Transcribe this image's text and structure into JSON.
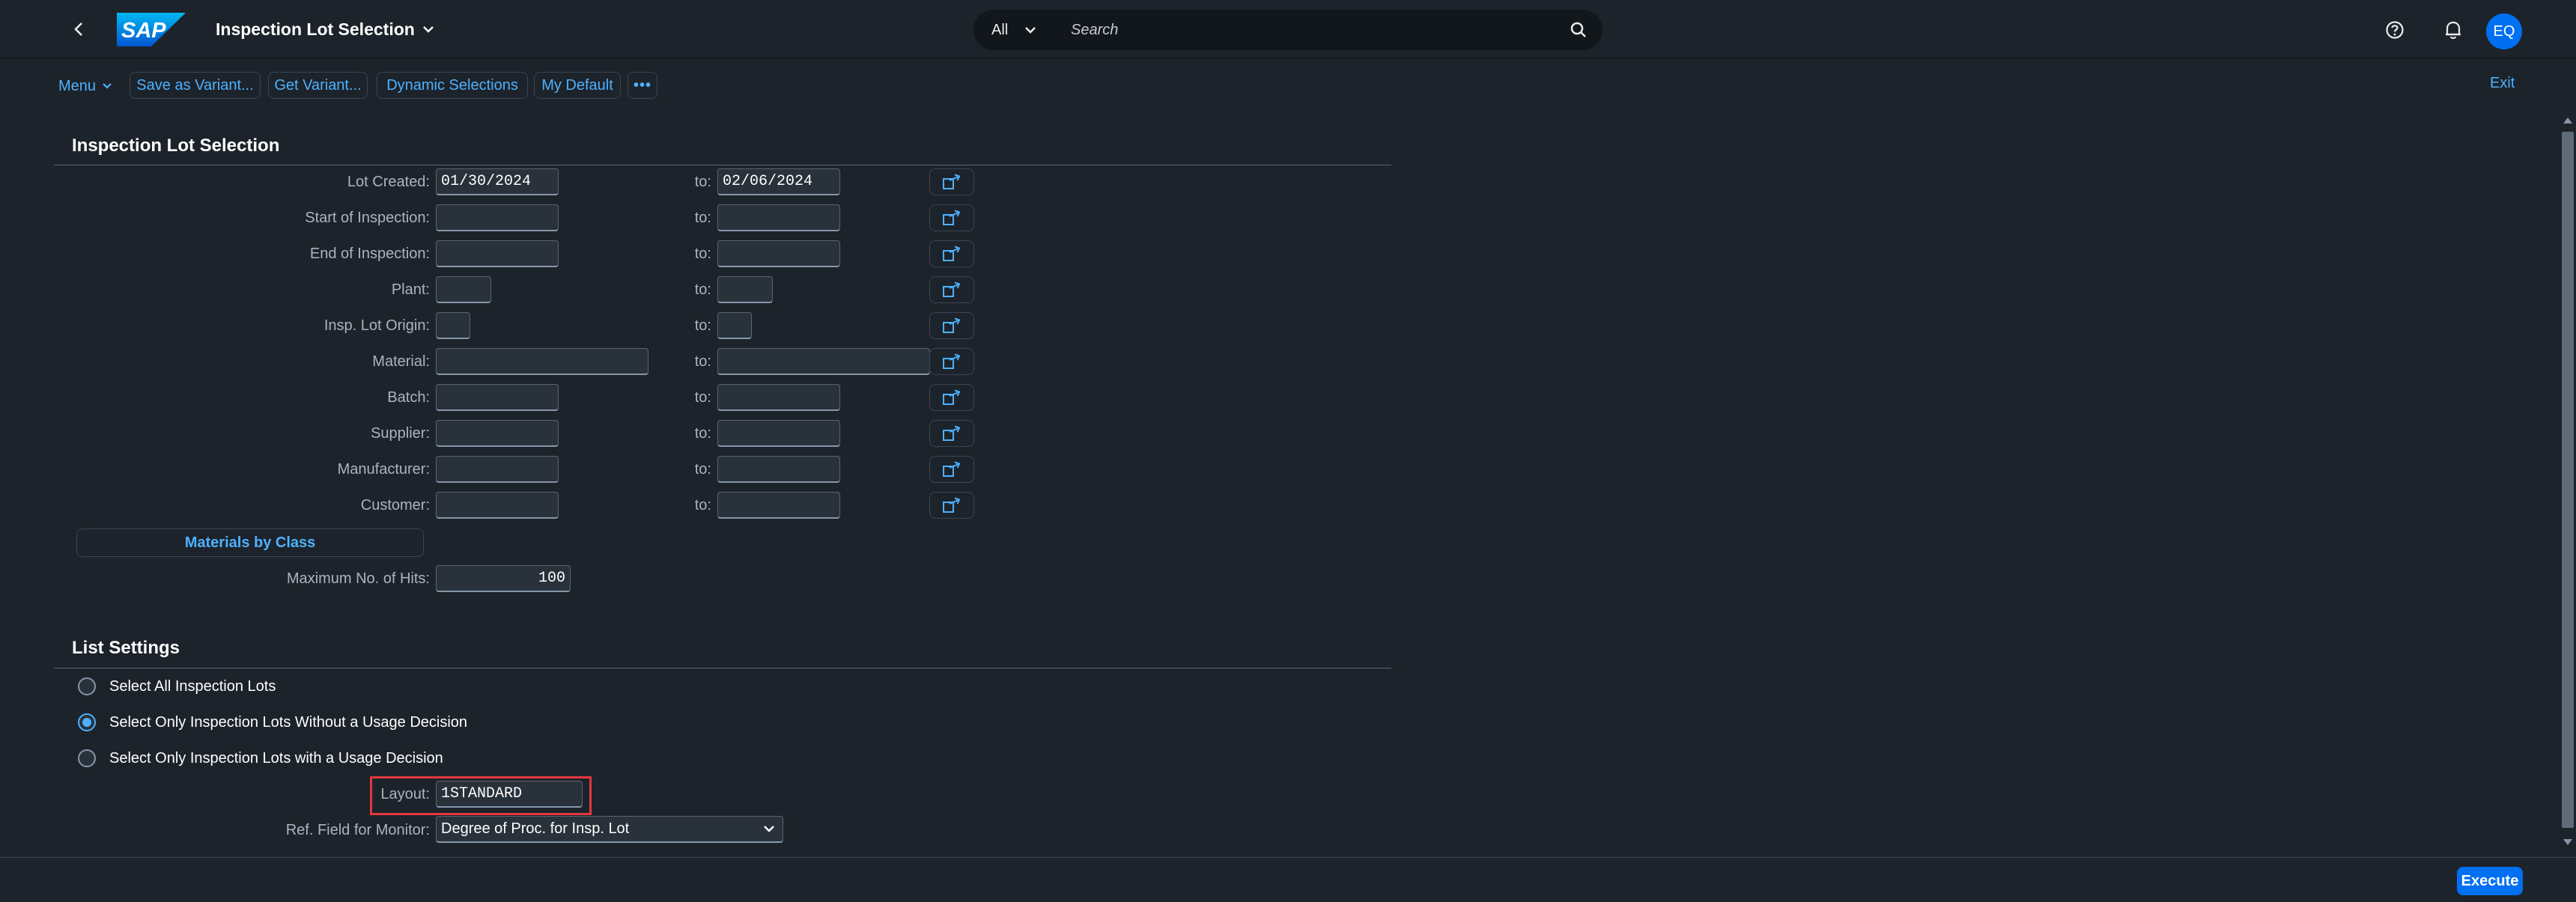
{
  "shell": {
    "title": "Inspection Lot Selection",
    "search_scope": "All",
    "search_placeholder": "Search",
    "avatar_initials": "EQ"
  },
  "toolbar": {
    "menu_label": "Menu",
    "save_variant": "Save as Variant...",
    "get_variant": "Get Variant...",
    "dynamic_selections": "Dynamic Selections",
    "my_default": "My Default",
    "more": "•••",
    "exit": "Exit"
  },
  "selection": {
    "title": "Inspection Lot Selection",
    "to_label": "to:",
    "rows": [
      {
        "label": "Lot Created:",
        "from": "01/30/2024",
        "to": "02/06/2024"
      },
      {
        "label": "Start of Inspection:",
        "from": "",
        "to": ""
      },
      {
        "label": "End of Inspection:",
        "from": "",
        "to": ""
      },
      {
        "label": "Plant:",
        "from": "",
        "to": ""
      },
      {
        "label": "Insp. Lot Origin:",
        "from": "",
        "to": ""
      },
      {
        "label": "Material:",
        "from": "",
        "to": ""
      },
      {
        "label": "Batch:",
        "from": "",
        "to": ""
      },
      {
        "label": "Supplier:",
        "from": "",
        "to": ""
      },
      {
        "label": "Manufacturer:",
        "from": "",
        "to": ""
      },
      {
        "label": "Customer:",
        "from": "",
        "to": ""
      }
    ],
    "materials_by_class": "Materials by Class",
    "max_hits_label": "Maximum No. of Hits:",
    "max_hits_value": "100"
  },
  "list_settings": {
    "title": "List Settings",
    "options": [
      {
        "label": "Select All Inspection Lots",
        "selected": false
      },
      {
        "label": "Select Only Inspection Lots Without a Usage Decision",
        "selected": true
      },
      {
        "label": "Select Only Inspection Lots with a Usage Decision",
        "selected": false
      }
    ],
    "layout_label": "Layout:",
    "layout_value": "1STANDARD",
    "ref_field_label": "Ref. Field for Monitor:",
    "ref_field_value": "Degree of Proc. for Insp. Lot"
  },
  "footer": {
    "execute": "Execute"
  },
  "colors": {
    "background": "#1d232a",
    "accent": "#0070f2",
    "link": "#4db1ff",
    "highlight_border": "#e3383f"
  }
}
